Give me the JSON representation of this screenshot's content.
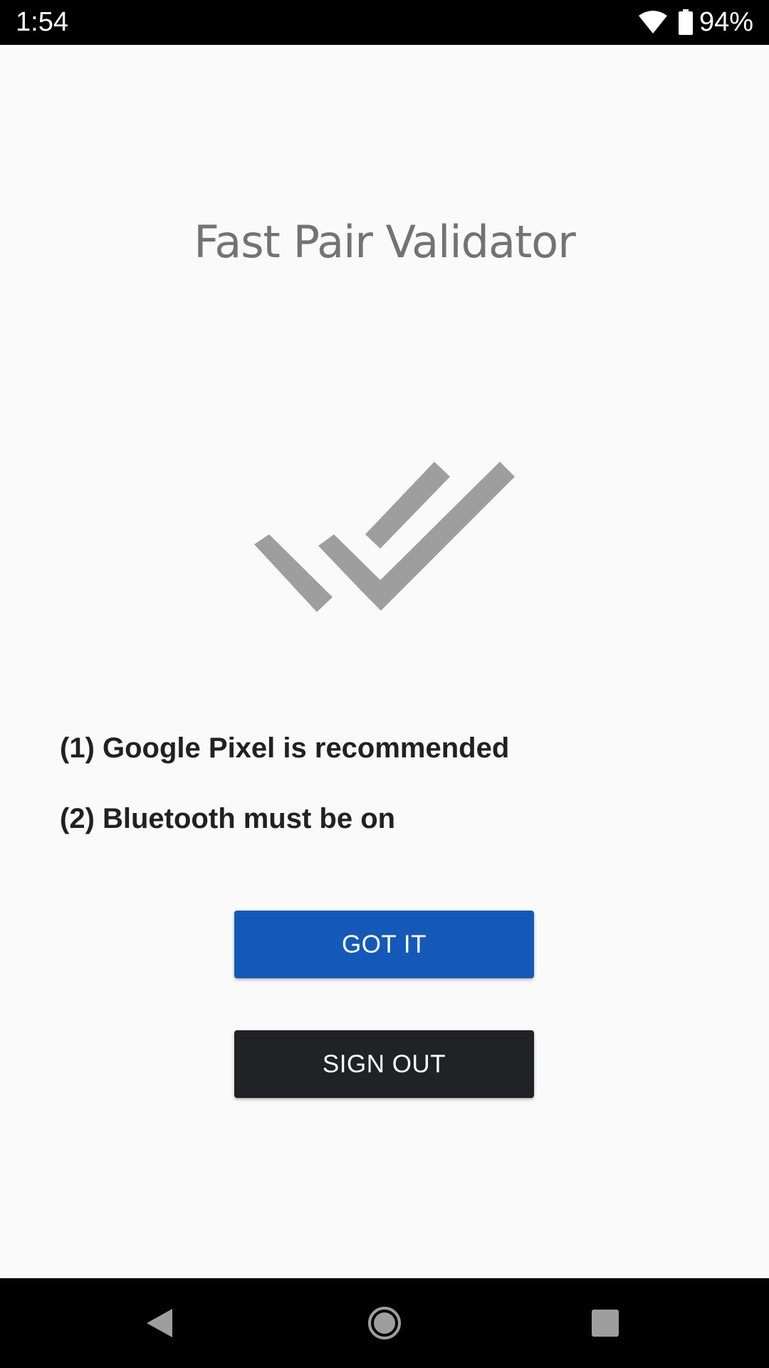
{
  "status_bar": {
    "time": "1:54",
    "battery_percent": "94%",
    "icons": [
      "wifi-icon",
      "battery-icon"
    ]
  },
  "app": {
    "title": "Fast Pair Validator",
    "logo_icon": "double-check-icon",
    "logo_color": "#9e9e9e"
  },
  "requirements": [
    "(1) Google Pixel is recommended",
    "(2) Bluetooth must be on"
  ],
  "buttons": {
    "got_it": "GOT IT",
    "sign_out": "SIGN OUT",
    "got_it_color": "#1559b8",
    "sign_out_color": "#212226"
  },
  "nav_bar": {
    "icons": [
      "back-icon",
      "home-icon",
      "recents-icon"
    ]
  }
}
